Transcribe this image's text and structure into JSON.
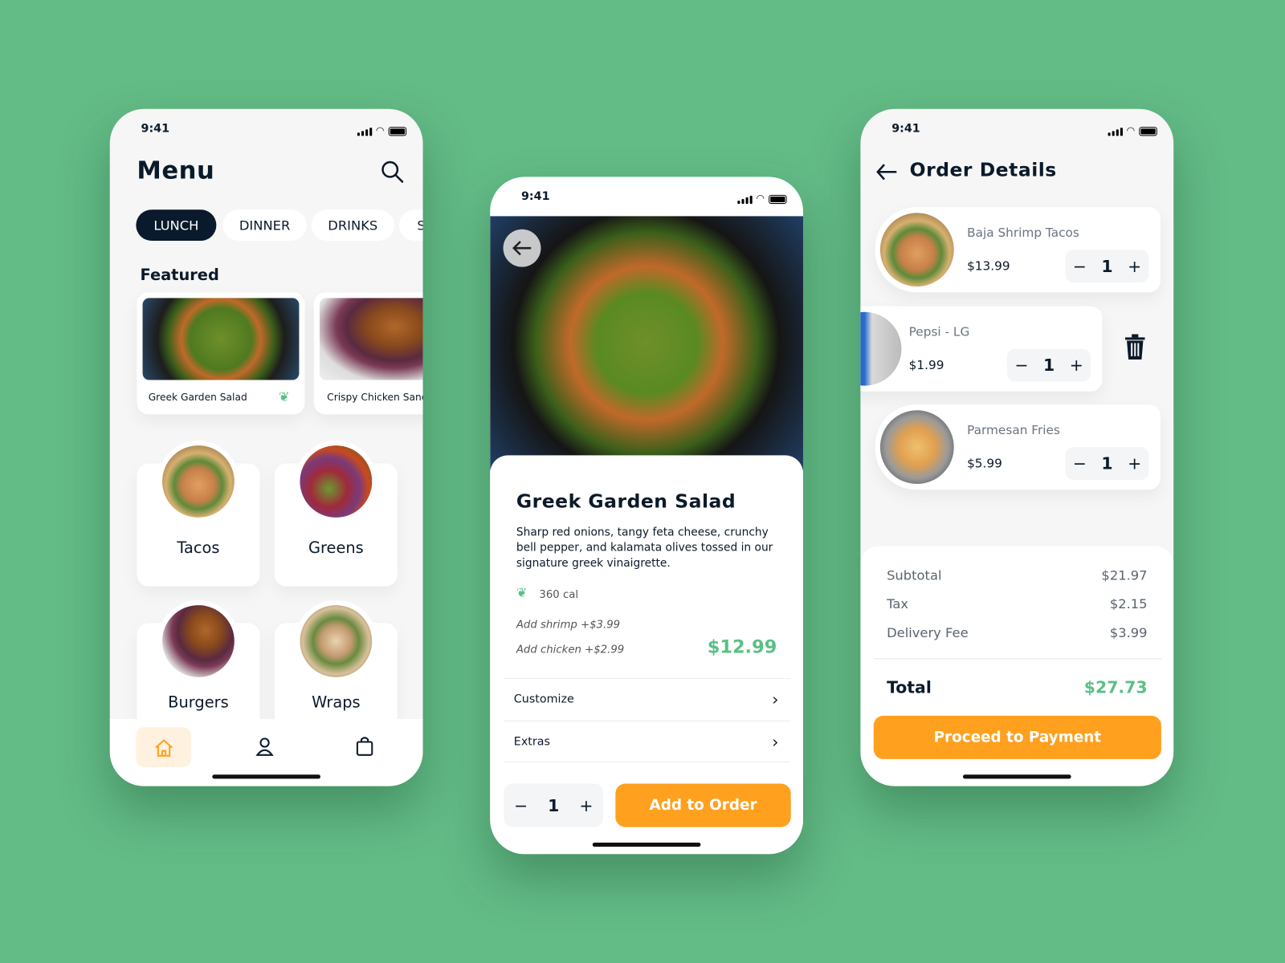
{
  "status": {
    "time": "9:41"
  },
  "menu": {
    "title": "Menu",
    "tabs": [
      "LUNCH",
      "DINNER",
      "DRINKS",
      "S"
    ],
    "featured_label": "Featured",
    "featured": [
      {
        "name": "Greek Garden Salad"
      },
      {
        "name": "Crispy Chicken Sandw"
      }
    ],
    "categories": [
      "Tacos",
      "Greens",
      "Burgers",
      "Wraps"
    ]
  },
  "detail": {
    "title": "Greek Garden Salad",
    "description": "Sharp red onions, tangy feta cheese, crunchy bell pepper, and kalamata olives tossed in our signature greek vinaigrette.",
    "calories": "360 cal",
    "addons": [
      "Add shrimp +$3.99",
      "Add chicken +$2.99"
    ],
    "price": "$12.99",
    "rows": [
      "Customize",
      "Extras"
    ],
    "quantity": "1",
    "minus": "−",
    "plus": "+",
    "add_button": "Add to Order"
  },
  "order": {
    "title": "Order Details",
    "items": [
      {
        "name": "Baja Shrimp Tacos",
        "price": "$13.99",
        "qty": "1"
      },
      {
        "name": "Pepsi - LG",
        "price": "$1.99",
        "qty": "1"
      },
      {
        "name": "Parmesan Fries",
        "price": "$5.99",
        "qty": "1"
      }
    ],
    "summary": [
      {
        "label": "Subtotal",
        "value": "$21.97"
      },
      {
        "label": "Tax",
        "value": "$2.15"
      },
      {
        "label": "Delivery Fee",
        "value": "$3.99"
      }
    ],
    "total_label": "Total",
    "total": "$27.73",
    "pay_button": "Proceed to Payment"
  },
  "colors": {
    "background": "#63bb86",
    "accent_orange": "#ffa01f",
    "accent_green": "#5bbf86",
    "dark": "#081a2b"
  }
}
